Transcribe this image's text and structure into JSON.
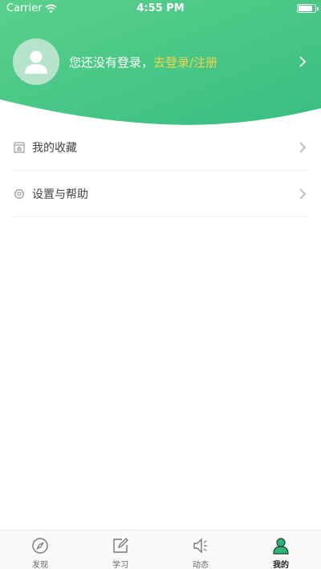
{
  "colors": {
    "brand_green": "#3cc484",
    "brand_green_light": "#52cc86",
    "login_link": "#f3d44b",
    "avatar_bg": "#b5e3cc"
  },
  "status_bar": {
    "carrier": "Carrier",
    "time": "4:55 PM"
  },
  "profile": {
    "avatar_icon": "user-icon",
    "prompt": "您还没有登录，",
    "login_link": "去登录/注册"
  },
  "menu": {
    "items": [
      {
        "label": "我的收藏",
        "icon": "bookmark-icon"
      },
      {
        "label": "设置与帮助",
        "icon": "gear-icon"
      }
    ]
  },
  "tabbar": {
    "tabs": [
      {
        "label": "发现",
        "icon": "compass-icon",
        "active": false
      },
      {
        "label": "学习",
        "icon": "edit-icon",
        "active": false
      },
      {
        "label": "动态",
        "icon": "speaker-icon",
        "active": false
      },
      {
        "label": "我的",
        "icon": "user-icon",
        "active": true
      }
    ]
  }
}
